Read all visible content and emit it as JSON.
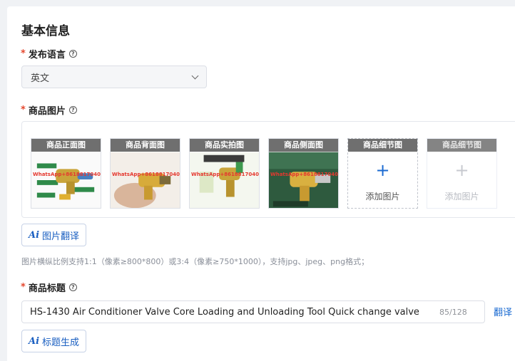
{
  "section": {
    "title": "基本信息"
  },
  "language": {
    "label": "发布语言",
    "required_mark": "*",
    "help_icon": "question-circle-icon",
    "value": "英文",
    "dropdown_icon": "chevron-down-icon"
  },
  "images": {
    "label": "商品图片",
    "required_mark": "*",
    "help_icon": "question-circle-icon",
    "slots": [
      {
        "caption": "商品正面图",
        "watermark": "WhatsApp+8618817040688"
      },
      {
        "caption": "商品背面图",
        "watermark": "WhatsApp+8618817040688"
      },
      {
        "caption": "商品实拍图",
        "watermark": "WhatsApp+8618817040688"
      },
      {
        "caption": "商品侧面图",
        "watermark": "WhatsApp+8618817040688"
      },
      {
        "caption": "商品细节图",
        "plus": "+",
        "add_text": "添加图片"
      },
      {
        "caption": "商品细节图",
        "plus": "+",
        "add_text": "添加图片"
      }
    ],
    "translate_button": {
      "ai_mark": "Ai",
      "label": "图片翻译"
    },
    "hint": "图片横纵比例支持1:1（像素≥800*800）或3:4（像素≥750*1000），支持jpg、jpeg、png格式；"
  },
  "product_title": {
    "label": "商品标题",
    "required_mark": "*",
    "help_icon": "question-circle-icon",
    "value": "HS-1430 Air Conditioner Valve Core Loading and Unloading Tool Quick change valve",
    "counter": "85/128",
    "translate_link": "翻译",
    "generate_button": {
      "ai_mark": "Ai",
      "label": "标题生成"
    }
  },
  "colors": {
    "required": "#e5482f",
    "accent": "#1a6ad1",
    "hint": "#8a8f99"
  }
}
